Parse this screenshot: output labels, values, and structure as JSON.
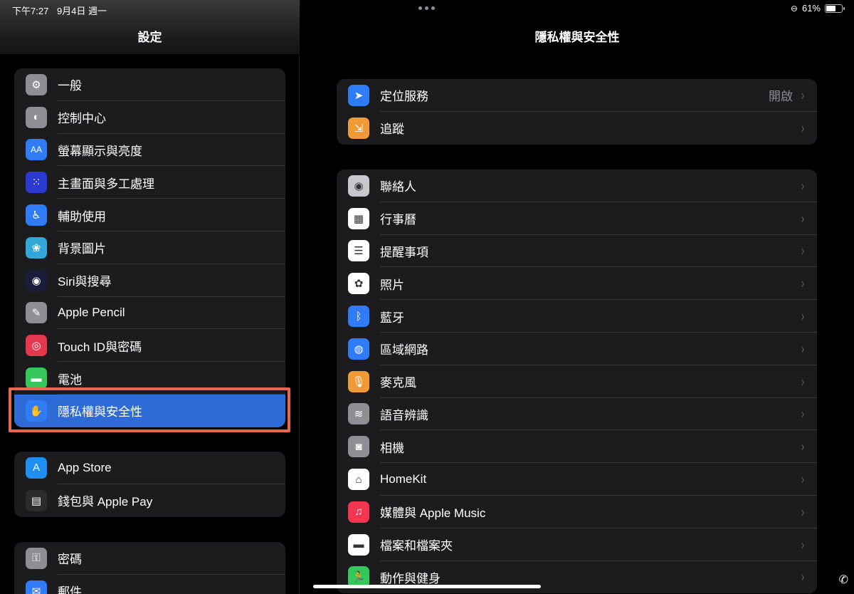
{
  "status": {
    "time": "下午7:27",
    "date": "9月4日 週一",
    "battery_percent": "61%",
    "battery_level": 0.61
  },
  "sidebar": {
    "title": "設定",
    "groups": [
      {
        "items": [
          {
            "label": "一般",
            "icon": "gear-icon",
            "color": "#8e8e93",
            "glyph": "⚙"
          },
          {
            "label": "控制中心",
            "icon": "toggles-icon",
            "color": "#8e8e93",
            "glyph": "◐"
          },
          {
            "label": "螢幕顯示與亮度",
            "icon": "text-size-icon",
            "color": "#2f7cf6",
            "glyph": "AA"
          },
          {
            "label": "主畫面與多工處理",
            "icon": "app-grid-icon",
            "color": "#2b3bd1",
            "glyph": "⁙"
          },
          {
            "label": "輔助使用",
            "icon": "accessibility-icon",
            "color": "#2f7cf6",
            "glyph": "♿"
          },
          {
            "label": "背景圖片",
            "icon": "flower-icon",
            "color": "#33a7d8",
            "glyph": "❀"
          },
          {
            "label": "Siri與搜尋",
            "icon": "siri-icon",
            "color": "#1b1b3a",
            "glyph": "◉"
          },
          {
            "label": "Apple Pencil",
            "icon": "pencil-icon",
            "color": "#8e8e93",
            "glyph": "✎"
          },
          {
            "label": "Touch ID與密碼",
            "icon": "fingerprint-icon",
            "color": "#e5384e",
            "glyph": "◎"
          },
          {
            "label": "電池",
            "icon": "battery-icon",
            "color": "#35c759",
            "glyph": "▬"
          },
          {
            "label": "隱私權與安全性",
            "icon": "hand-icon",
            "color": "#2f7cf6",
            "glyph": "✋",
            "selected": true
          }
        ]
      },
      {
        "items": [
          {
            "label": "App Store",
            "icon": "app-store-icon",
            "color": "#1f8ef1",
            "glyph": "A"
          },
          {
            "label": "錢包與 Apple Pay",
            "icon": "wallet-icon",
            "color": "#2c2c2e",
            "glyph": "▤"
          }
        ]
      },
      {
        "items": [
          {
            "label": "密碼",
            "icon": "key-icon",
            "color": "#8e8e93",
            "glyph": "⚿"
          },
          {
            "label": "郵件",
            "icon": "mail-icon",
            "color": "#2f7cf6",
            "glyph": "✉"
          }
        ]
      }
    ]
  },
  "detail": {
    "title": "隱私權與安全性",
    "groups": [
      {
        "items": [
          {
            "label": "定位服務",
            "value": "開啟",
            "icon": "location-arrow-icon",
            "color": "#2f7cf6",
            "glyph": "➤"
          },
          {
            "label": "追蹤",
            "value": "",
            "icon": "tracking-icon",
            "color": "#f09a37",
            "glyph": "⇲"
          }
        ]
      },
      {
        "items": [
          {
            "label": "聯絡人",
            "value": "",
            "icon": "contacts-icon",
            "color": "#c7c7cc",
            "glyph": "◉"
          },
          {
            "label": "行事曆",
            "value": "",
            "icon": "calendar-icon",
            "color": "#ffffff",
            "glyph": "▦"
          },
          {
            "label": "提醒事項",
            "value": "",
            "icon": "reminders-icon",
            "color": "#ffffff",
            "glyph": "☰"
          },
          {
            "label": "照片",
            "value": "",
            "icon": "photos-icon",
            "color": "#ffffff",
            "glyph": "✿"
          },
          {
            "label": "藍牙",
            "value": "",
            "icon": "bluetooth-icon",
            "color": "#2f7cf6",
            "glyph": "ᛒ"
          },
          {
            "label": "區域網路",
            "value": "",
            "icon": "globe-icon",
            "color": "#2f7cf6",
            "glyph": "◍"
          },
          {
            "label": "麥克風",
            "value": "",
            "icon": "microphone-icon",
            "color": "#f09a37",
            "glyph": "🎙"
          },
          {
            "label": "語音辨識",
            "value": "",
            "icon": "waveform-icon",
            "color": "#8e8e93",
            "glyph": "≋"
          },
          {
            "label": "相機",
            "value": "",
            "icon": "camera-icon",
            "color": "#8e8e93",
            "glyph": "◙"
          },
          {
            "label": "HomeKit",
            "value": "",
            "icon": "home-icon",
            "color": "#ffffff",
            "glyph": "⌂"
          },
          {
            "label": "媒體與 Apple Music",
            "value": "",
            "icon": "music-note-icon",
            "color": "#f2364f",
            "glyph": "♫"
          },
          {
            "label": "檔案和檔案夾",
            "value": "",
            "icon": "folder-icon",
            "color": "#ffffff",
            "glyph": "▬"
          },
          {
            "label": "動作與健身",
            "value": "",
            "icon": "fitness-icon",
            "color": "#35c759",
            "glyph": "🏃"
          }
        ]
      }
    ]
  }
}
